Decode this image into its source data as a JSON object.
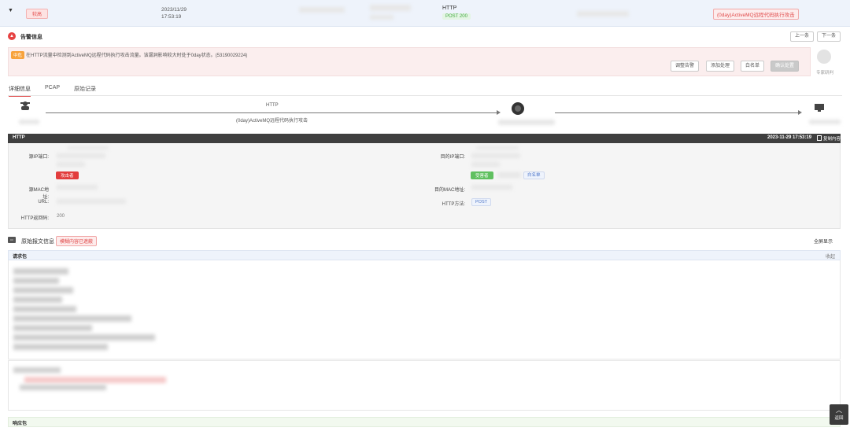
{
  "row": {
    "severity": "较高",
    "date": "2023/11/29",
    "time": "17:53:19",
    "protocol": "HTTP",
    "method": "POST",
    "status": "200",
    "title": "(0day)ActiveMQ远程代码执行攻击"
  },
  "alert": {
    "section_title": "告警信息",
    "prev_label": "上一条",
    "next_label": "下一条",
    "level": "中危",
    "description": "在HTTP流量中检测到ActiveMQ远程代码执行攻击流量。该漏洞影响较大时处于0day状态。(53190029224)",
    "buttons": [
      "调整告警",
      "添加处理",
      "白名单",
      "确认处置"
    ],
    "expert_label": "专家研判"
  },
  "tabs": [
    "详细信息",
    "PCAP",
    "原始记录"
  ],
  "flow": {
    "protocol": "HTTP",
    "attack_name": "(0day)ActiveMQ远程代码执行攻击"
  },
  "detail": {
    "bar_label": "HTTP",
    "timestamp": "2023-11-29 17:53:19",
    "copy_label": "复制内容",
    "src_ip_label": "源IP端口:",
    "dst_ip_label": "目的IP端口:",
    "attacker_tag": "攻击者",
    "victim_tag": "受害者",
    "whitelist_label": "白名单",
    "src_mac_label": "源MAC地址:",
    "dst_mac_label": "目的MAC地址:",
    "url_label": "URL:",
    "http_method_label": "HTTP方法:",
    "http_method_value": "POST",
    "status_label": "HTTP返回码:",
    "status_value": "200"
  },
  "raw": {
    "title": "原始报文信息",
    "note": "模糊内容已遮蔽",
    "fullscreen_label": "全屏显示",
    "request_label": "请求包",
    "request_right": "收起",
    "response_label": "响应包"
  },
  "back_to_top": "返回"
}
